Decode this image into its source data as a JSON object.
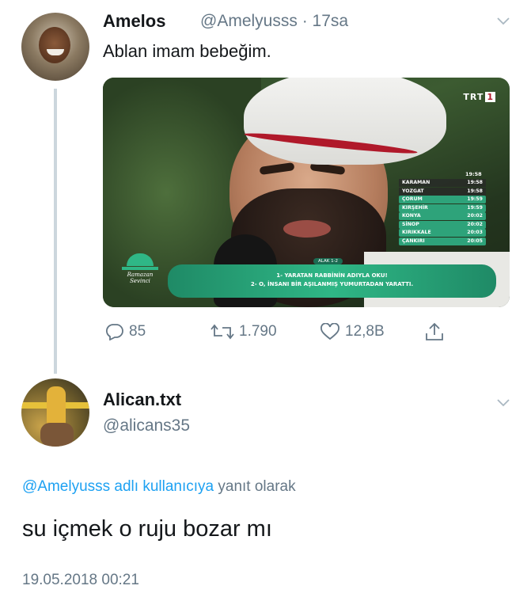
{
  "tweet1": {
    "display_name": "Amelos",
    "handle": "@Amelyusss",
    "separator": "·",
    "time_ago": "17sa",
    "text": "Ablan imam bebeğim.",
    "media": {
      "channel_logo": "TRT",
      "channel_logo_num": "1",
      "top_time": "19:58",
      "city_times": [
        {
          "city": "KARAMAN",
          "time": "19:58",
          "style": "dark"
        },
        {
          "city": "YOZGAT",
          "time": "19:58",
          "style": "dark"
        },
        {
          "city": "ÇORUM",
          "time": "19:59",
          "style": "green"
        },
        {
          "city": "KIRŞEHİR",
          "time": "19:59",
          "style": "green"
        },
        {
          "city": "KONYA",
          "time": "20:02",
          "style": "green"
        },
        {
          "city": "SİNOP",
          "time": "20:02",
          "style": "green"
        },
        {
          "city": "KIRIKKALE",
          "time": "20:03",
          "style": "green"
        },
        {
          "city": "ÇANKIRI",
          "time": "20:05",
          "style": "green"
        }
      ],
      "verse_tag": "ALAK 1-2",
      "verse_line1": "1- YARATAN RABBİNİN ADIYLA OKU!",
      "verse_line2": "2- O, İNSANI BİR AŞILANMIŞ YUMURTADAN YARATTI.",
      "program_logo_line1": "Ramazan",
      "program_logo_line2": "Sevinci"
    },
    "actions": {
      "replies": "85",
      "retweets": "1.790",
      "likes": "12,8B"
    }
  },
  "tweet2": {
    "display_name": "Alican.txt",
    "handle": "@alicans35",
    "reply_to_handle": "@Amelyusss adlı kullanıcıya",
    "reply_to_suffix": "yanıt olarak",
    "text": "su içmek o ruju bozar mı",
    "timestamp": "19.05.2018 00:21"
  },
  "colors": {
    "text_primary": "#14171a",
    "text_secondary": "#657786",
    "link": "#1da1f2",
    "thread_line": "#ccd6dd",
    "verse_banner": "#2fb786"
  },
  "icons": [
    "reply-icon",
    "retweet-icon",
    "like-icon",
    "share-icon",
    "chevron-down-icon"
  ]
}
